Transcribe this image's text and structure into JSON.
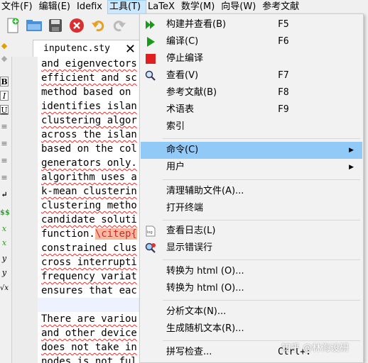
{
  "menubar": {
    "items": [
      "文件(F)",
      "编辑(E)",
      "Idefix",
      "工具(T)",
      "LaTeX",
      "数学(M)",
      "向导(W)",
      "参考文献"
    ],
    "active_index": 3
  },
  "toolbar": {
    "icons": [
      "new-file-icon",
      "open-folder-icon",
      "save-icon",
      "close-red-icon",
      "undo-icon",
      "redo-icon"
    ]
  },
  "side_palette": {
    "symbols": [
      "B",
      "I",
      "U",
      "≡",
      "≡",
      "≡",
      "≡",
      "↵",
      "$$",
      "x",
      "x",
      "y",
      "y",
      "√x"
    ]
  },
  "tab": {
    "filename": "inputenc.sty",
    "close_glyph": "✕"
  },
  "editor": {
    "lines": [
      "and eigenvectors",
      "efficient and sc",
      "method based on",
      "identifies islan",
      "clustering algor",
      "across the islan",
      "based on the col",
      "generators only.",
      "algorithm uses a",
      "k-mean clusterin",
      "clustering metho",
      "candidate soluti",
      "function.",
      "constrained clus",
      "cross interrupti",
      "frequency variat",
      "ensures that eac",
      "",
      "There are variou",
      "and other device",
      "does not take in",
      "nodes is not ful"
    ],
    "cite_text": "\\citep{"
  },
  "tools_menu": {
    "items": [
      {
        "label": "构建并查看(B)",
        "shortcut": "F5",
        "icon": "build-view-icon"
      },
      {
        "label": "编译(C)",
        "shortcut": "F6",
        "icon": "compile-icon"
      },
      {
        "label": "停止编译",
        "shortcut": "",
        "icon": "stop-icon"
      },
      {
        "label": "查看(V)",
        "shortcut": "F7",
        "icon": "view-magnifier-icon"
      },
      {
        "label": "参考文献(B)",
        "shortcut": "F8",
        "icon": ""
      },
      {
        "label": "术语表",
        "shortcut": "F9",
        "icon": ""
      },
      {
        "label": "索引",
        "shortcut": "",
        "icon": ""
      },
      {
        "label": "命令(C)",
        "shortcut": "",
        "icon": "",
        "submenu": true
      },
      {
        "label": "用户",
        "shortcut": "",
        "icon": "",
        "submenu": true
      },
      {
        "label": "清理辅助文件(A)...",
        "shortcut": "",
        "icon": ""
      },
      {
        "label": "打开终端",
        "shortcut": "",
        "icon": ""
      },
      {
        "label": "查看日志(L)",
        "shortcut": "",
        "icon": "log-icon"
      },
      {
        "label": "显示错误行",
        "shortcut": "",
        "icon": "error-line-icon"
      },
      {
        "label": "转换为 html (O)...",
        "shortcut": "",
        "icon": ""
      },
      {
        "label": "转换为 html (O)...",
        "shortcut": "",
        "icon": ""
      },
      {
        "label": "分析文本(N)...",
        "shortcut": "",
        "icon": ""
      },
      {
        "label": "生成随机文本(R)...",
        "shortcut": "",
        "icon": ""
      },
      {
        "label": "拼写检查...",
        "shortcut": "Ctrl+:",
        "icon": ""
      }
    ],
    "highlighted_index": 7
  },
  "watermark": "知乎 @林海设研",
  "colors": {
    "menu_highlight": "#91c9f7",
    "cite_bg": "#f8b8a0",
    "compile_green": "#1a9a1a",
    "stop_red": "#e02020"
  }
}
